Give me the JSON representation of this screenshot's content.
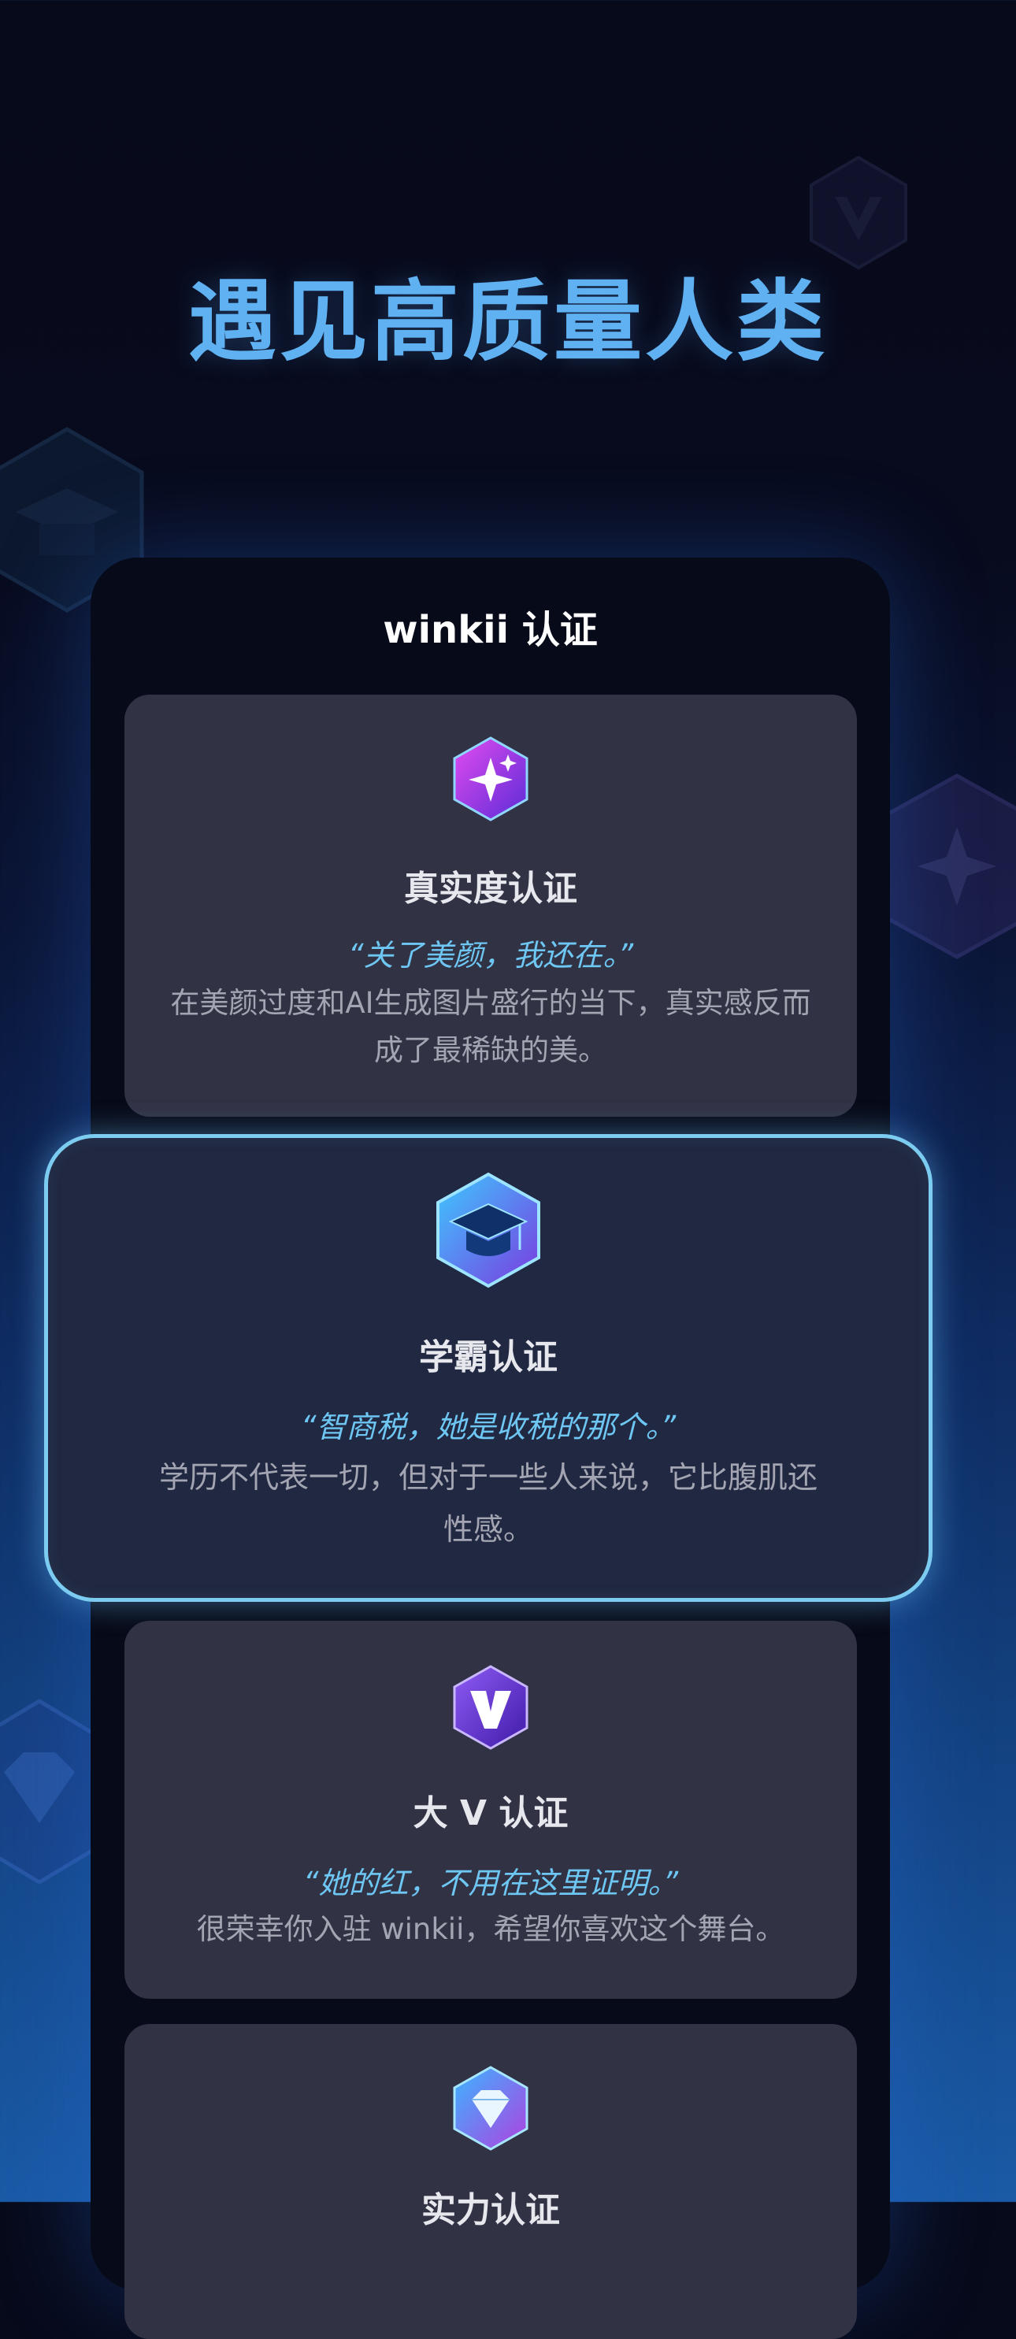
{
  "headline": "遇见高质量人类",
  "panel": {
    "title": "winkii 认证"
  },
  "cards": [
    {
      "title": "真实度认证",
      "quote": "“关了美颜，我还在。”",
      "desc_line1": "在美颜过度和AI生成图片盛行的当下，真实感反而",
      "desc_line2": "成了最稀缺的美。",
      "icon": "sparkle-badge-icon"
    },
    {
      "title": "学霸认证",
      "quote": "“智商税，她是收税的那个。”",
      "desc_line1": "学历不代表一切，但对于一些人来说，它比腹肌还",
      "desc_line2": "性感。",
      "icon": "graduation-cap-badge-icon"
    },
    {
      "title": "大 V 认证",
      "quote": "“她的红，不用在这里证明。”",
      "desc_line1": "很荣幸你入驻 winkii，希望你喜欢这个舞台。",
      "icon": "v-badge-icon"
    },
    {
      "title": "实力认证",
      "icon": "diamond-badge-icon"
    }
  ],
  "colors": {
    "headline": "#5fb1f2",
    "quote": "#6ec6f3",
    "featured_border": "#7ccbf0",
    "card_bg": "#313244",
    "featured_bg": "#212841"
  }
}
